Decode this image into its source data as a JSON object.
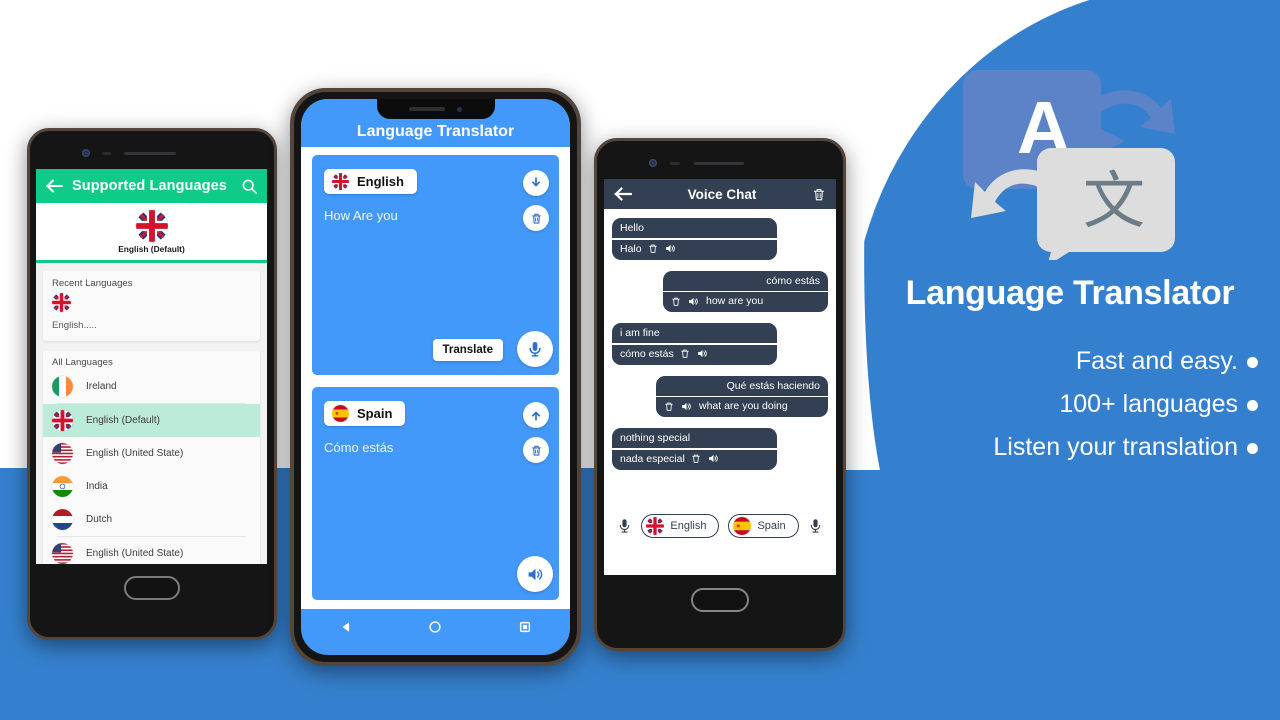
{
  "colors": {
    "bg_blue": "#3580ce",
    "app_blue": "#4399f9",
    "green": "#0fcb88",
    "navy": "#333f52",
    "white": "#ffffff"
  },
  "phone1": {
    "appbar": {
      "title": "Supported Languages",
      "back_icon": "back-arrow-icon",
      "search_icon": "search-icon"
    },
    "hero": {
      "flag": "uk-flag",
      "label": "English (Default)"
    },
    "recent": {
      "heading": "Recent Languages",
      "item_flag": "uk-flag",
      "item_label": "English....."
    },
    "all": {
      "heading": "All Languages",
      "items": [
        {
          "label": "Ireland",
          "flag": "ireland-flag",
          "selected": false
        },
        {
          "label": "English (Default)",
          "flag": "uk-flag",
          "selected": true
        },
        {
          "label": "English (United State)",
          "flag": "usa-flag",
          "selected": false
        },
        {
          "label": "India",
          "flag": "india-flag",
          "selected": false
        },
        {
          "label": "Dutch",
          "flag": "netherlands-flag",
          "selected": false
        },
        {
          "label": "English (United State)",
          "flag": "usa-flag",
          "selected": false
        }
      ]
    }
  },
  "phone2": {
    "appbar": {
      "title": "Language Translator"
    },
    "source": {
      "language": "English",
      "flag": "uk-flag",
      "text": "How Are you",
      "download_icon": "download-arrow-icon",
      "delete_icon": "trash-icon",
      "mic_icon": "microphone-icon",
      "translate_label": "Translate"
    },
    "target": {
      "language": "Spain",
      "flag": "spain-flag",
      "text": "Cómo estás",
      "upload_icon": "upload-arrow-icon",
      "delete_icon": "trash-icon",
      "speaker_icon": "speaker-icon"
    },
    "navbar": {
      "back_icon": "nav-back-icon",
      "home_icon": "nav-home-icon",
      "recents_icon": "nav-recents-icon"
    }
  },
  "phone3": {
    "appbar": {
      "title": "Voice Chat",
      "back_icon": "back-arrow-icon",
      "delete_icon": "trash-icon"
    },
    "messages": [
      {
        "side": "left",
        "original": "Hello",
        "translation": "Halo"
      },
      {
        "side": "right",
        "original": "cómo estás",
        "translation": "how are you"
      },
      {
        "side": "left",
        "original": "i am fine",
        "translation": "cómo estás"
      },
      {
        "side": "right",
        "original": "Qué estás haciendo",
        "translation": "what are you doing"
      },
      {
        "side": "left",
        "original": "nothing special",
        "translation": "nada especial"
      }
    ],
    "bottom_bar": {
      "left_mic_icon": "microphone-icon",
      "right_mic_icon": "microphone-icon",
      "left_lang": {
        "label": "English",
        "flag": "uk-flag"
      },
      "right_lang": {
        "label": "Spain",
        "flag": "spain-flag"
      }
    }
  },
  "promo": {
    "logo": {
      "letter_a": "A",
      "glyph_cjk": "文",
      "icon": "translate-logo-icon"
    },
    "title": "Language Translator",
    "features": [
      "Fast and easy.",
      "100+ languages",
      "Listen your translation"
    ]
  }
}
